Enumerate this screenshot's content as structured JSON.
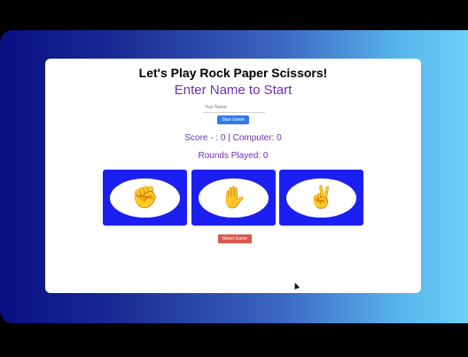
{
  "game": {
    "title": "Let's Play Rock Paper Scissors!",
    "subtitle": "Enter Name to Start",
    "name_input": {
      "placeholder": "Your Name",
      "value": ""
    },
    "start_button_label": "Start Game",
    "score_text": "Score - : 0 | Computer: 0",
    "rounds_text": "Rounds Played: 0",
    "choices": [
      {
        "name": "rock",
        "emoji": "✊"
      },
      {
        "name": "paper",
        "emoji": "✋"
      },
      {
        "name": "scissors",
        "emoji": "✌️"
      }
    ],
    "reset_button_label": "Reset Game"
  },
  "colors": {
    "card_bg": "#ffffff",
    "choice_bg": "#1b1ff0",
    "accent_text": "#6f2fb5",
    "start_button": "#2f7bea",
    "reset_button": "#d9584d",
    "background_gradient_start": "#0a0f82",
    "background_gradient_end": "#6bd1f7"
  }
}
